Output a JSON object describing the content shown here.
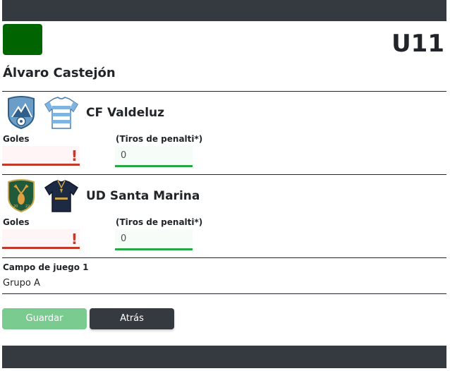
{
  "header": {
    "category": "U11"
  },
  "referee": {
    "name": "Álvaro Castejón"
  },
  "home": {
    "name": "CF Valdeluz",
    "goals_label": "Goles",
    "goals_value": "",
    "goals_warning": "!",
    "penalties_label": "(Tiros de penalti*)",
    "penalties_value": "0",
    "crest_icon": "shield-mountain-crest",
    "shirt_icon": "blue-white-striped-shirt"
  },
  "away": {
    "name": "UD Santa Marina",
    "goals_label": "Goles",
    "goals_value": "",
    "goals_warning": "!",
    "penalties_label": "(Tiros de penalti*)",
    "penalties_value": "0",
    "crest_icon": "shield-deer-crest",
    "shirt_icon": "navy-shirt"
  },
  "venue": {
    "field": "Campo de juego 1",
    "group": "Grupo A"
  },
  "actions": {
    "save_label": "Guardar",
    "back_label": "Atrás"
  },
  "colors": {
    "dark": "#343a40",
    "brand_green": "#006400",
    "save_green": "#7acb8f",
    "error_red": "#c0392b",
    "ok_green": "#28a745"
  }
}
